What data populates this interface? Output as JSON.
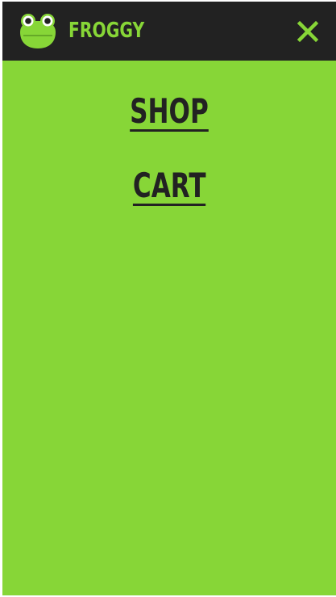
{
  "header": {
    "brand": "FROGGY",
    "logo_icon": "frog-face-icon",
    "close_icon": "close-x-icon"
  },
  "menu": {
    "items": [
      {
        "label": "SHOP"
      },
      {
        "label": "CART"
      }
    ]
  },
  "colors": {
    "accent_green": "#87d637",
    "header_dark": "#222222",
    "text_dark": "#222222"
  }
}
